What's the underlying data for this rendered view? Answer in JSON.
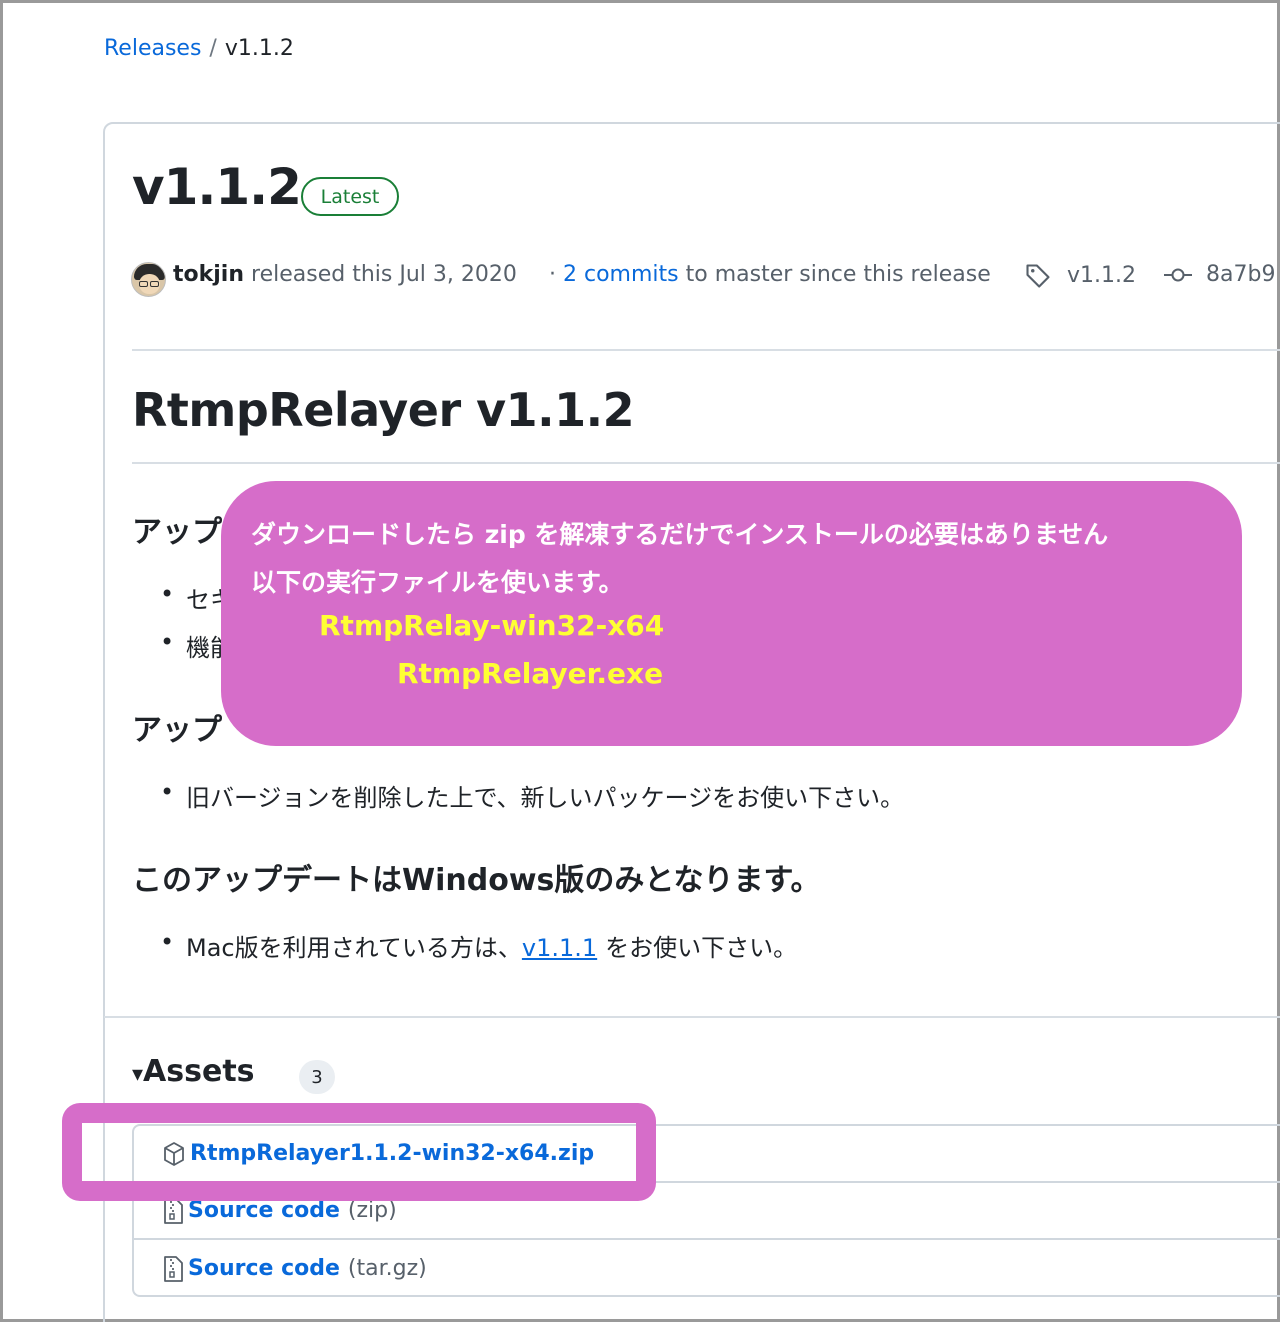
{
  "breadcrumb": {
    "link": "Releases",
    "separator": "/",
    "current": "v1.1.2"
  },
  "release": {
    "title": "v1.1.2",
    "badge": "Latest",
    "author": "tokjin",
    "released_text": "released this Jul 3, 2020",
    "commits_prefix": "·",
    "commits_link": "2 commits",
    "commits_suffix": "to master since this release",
    "tag": "v1.1.2",
    "commit": "8a7b9"
  },
  "body": {
    "heading": "RtmpRelayer v1.1.2",
    "section1_heading": "アップ",
    "section1_items": [
      "セキ",
      "機能"
    ],
    "section2_heading": "アップ",
    "section2_items": [
      "旧バージョンを削除した上で、新しいパッケージをお使い下さい。"
    ],
    "section3_heading": "このアップデートはWindows版のみとなります。",
    "section3_item_prefix": "Mac版を利用されている方は、",
    "section3_item_link": "v1.1.1",
    "section3_item_suffix": "をお使い下さい。"
  },
  "assets": {
    "title": "Assets",
    "toggle": "▾",
    "count": "3",
    "items": [
      {
        "name": "RtmpRelayer1.1.2-win32-x64.zip",
        "ext": "",
        "icon": "package-icon"
      },
      {
        "name": "Source code",
        "ext": "(zip)",
        "icon": "file-zip-icon"
      },
      {
        "name": "Source code",
        "ext": "(tar.gz)",
        "icon": "file-zip-icon"
      }
    ]
  },
  "callout": {
    "line1": "ダウンロードしたら zip を解凍するだけでインストールの必要はありません",
    "line2": "以下の実行ファイルを使います。",
    "line3": "RtmpRelay-win32-x64",
    "line4": "RtmpRelayer.exe"
  },
  "colors": {
    "accent": "#0969da",
    "latest": "#1a7f37",
    "callout": "#d66dc9",
    "callout_highlight": "#ffff33"
  }
}
